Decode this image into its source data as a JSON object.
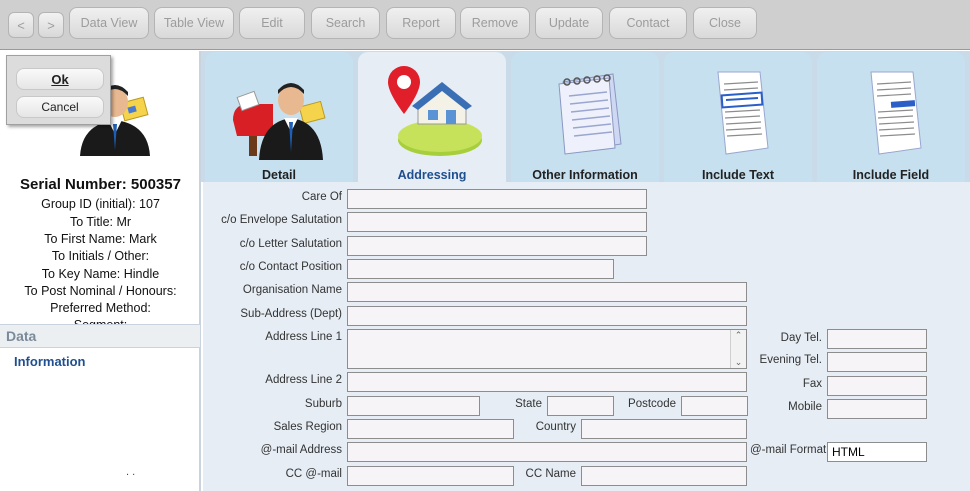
{
  "toolbar": {
    "back": "<",
    "forward": ">",
    "data_view": "Data View",
    "table_view": "Table View",
    "edit": "Edit",
    "search": "Search",
    "report": "Report",
    "remove": "Remove",
    "update": "Update",
    "contact": "Contact",
    "close": "Close"
  },
  "dialog": {
    "ok": "Ok",
    "cancel": "Cancel"
  },
  "record": {
    "serial": "Serial Number: 500357",
    "group_id": "Group ID (initial): 107",
    "to_title": "To Title: Mr",
    "to_first_name": "To First Name: Mark",
    "to_initials": "To Initials / Other:",
    "to_key_name": "To Key Name: Hindle",
    "to_post_nominal": "To Post Nominal / Honours:",
    "preferred_method": "Preferred Method:",
    "segment": "Segment:"
  },
  "sidebar": {
    "section": "Data",
    "link": "Information",
    "dots": ". ."
  },
  "tabs": [
    {
      "label": "Detail",
      "icon": "mailbox-person-icon"
    },
    {
      "label": "Addressing",
      "icon": "house-pin-icon"
    },
    {
      "label": "Other Information",
      "icon": "notepad-icon"
    },
    {
      "label": "Include Text",
      "icon": "document-text-icon"
    },
    {
      "label": "Include Field",
      "icon": "document-field-icon"
    }
  ],
  "form": {
    "care_of": {
      "label": "Care Of",
      "value": ""
    },
    "co_envelope": {
      "label": "c/o  Envelope Salutation",
      "value": ""
    },
    "co_letter": {
      "label": "c/o Letter Salutation",
      "value": ""
    },
    "co_contact_position": {
      "label": "c/o Contact Position",
      "value": ""
    },
    "organisation": {
      "label": "Organisation Name",
      "value": ""
    },
    "sub_address": {
      "label": "Sub-Address (Dept)",
      "value": ""
    },
    "address1": {
      "label": "Address Line 1",
      "value": ""
    },
    "address2": {
      "label": "Address Line 2",
      "value": ""
    },
    "suburb": {
      "label": "Suburb",
      "value": ""
    },
    "state": {
      "label": "State",
      "value": ""
    },
    "postcode": {
      "label": "Postcode",
      "value": ""
    },
    "sales_region": {
      "label": "Sales Region",
      "value": ""
    },
    "country": {
      "label": "Country",
      "value": ""
    },
    "email": {
      "label": "@-mail Address",
      "value": ""
    },
    "email_format": {
      "label": "@-mail Format",
      "value": "HTML"
    },
    "cc_email": {
      "label": "CC @-mail",
      "value": ""
    },
    "cc_name": {
      "label": "CC Name",
      "value": ""
    },
    "day_tel": {
      "label": "Day Tel.",
      "value": ""
    },
    "evening_tel": {
      "label": "Evening Tel.",
      "value": ""
    },
    "fax": {
      "label": "Fax",
      "value": ""
    },
    "mobile": {
      "label": "Mobile",
      "value": ""
    }
  }
}
